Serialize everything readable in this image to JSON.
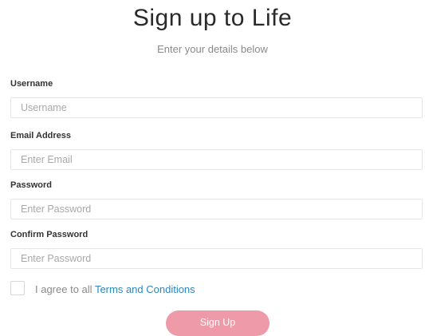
{
  "header": {
    "title": "Sign up to Life",
    "subtitle": "Enter your details below"
  },
  "form": {
    "username": {
      "label": "Username",
      "placeholder": "Username",
      "value": ""
    },
    "email": {
      "label": "Email Address",
      "placeholder": "Enter Email",
      "value": ""
    },
    "password": {
      "label": "Password",
      "placeholder": "Enter Password",
      "value": ""
    },
    "confirm_password": {
      "label": "Confirm Password",
      "placeholder": "Enter Password",
      "value": ""
    },
    "agreement": {
      "prefix": "I agree to all",
      "link_text": "Terms and Conditions",
      "checked": false
    },
    "submit_label": "Sign Up"
  },
  "colors": {
    "button": "#ef9aa8",
    "link": "#2f86b8",
    "label": "#333333",
    "muted_text": "#8a8a8a"
  }
}
